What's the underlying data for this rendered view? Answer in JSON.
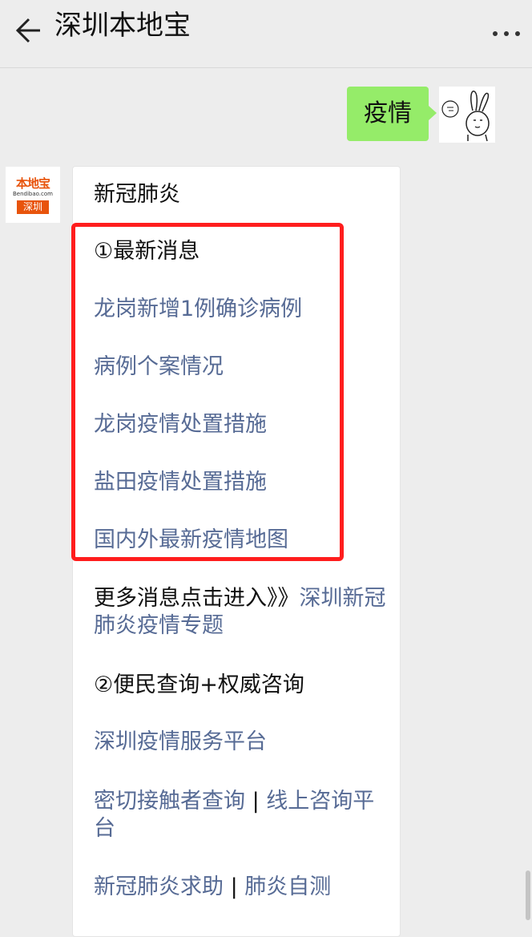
{
  "header": {
    "title": "深圳本地宝"
  },
  "user_message": {
    "text": "疫情"
  },
  "bot": {
    "logo": {
      "brand": "本地宝",
      "url": "Bendibao.com",
      "city": "深圳"
    },
    "intro": "新冠肺炎",
    "section1_heading": "①最新消息",
    "section1_links": [
      "龙岗新增1例确诊病例",
      "病例个案情况",
      "龙岗疫情处置措施",
      "盐田疫情处置措施",
      "国内外最新疫情地图"
    ],
    "more_prefix": "更多消息点击进入》》",
    "more_link": "深圳新冠肺炎疫情专题",
    "section2_heading": "②便民查询+权威咨询",
    "service_link": "深圳疫情服务平台",
    "contact_link": "密切接触者查询",
    "separator": " | ",
    "consult_link": "线上咨询平台",
    "help_link": "新冠肺炎求助",
    "selftest_link": "肺炎自测"
  },
  "colors": {
    "user_bubble": "#95ec69",
    "link": "#576b95",
    "highlight_box": "#ff1d1d",
    "logo_orange": "#e8540c"
  }
}
